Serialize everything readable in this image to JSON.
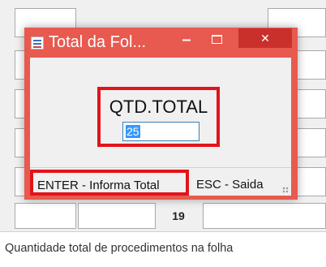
{
  "dialog": {
    "title": "Total da Fol...",
    "minimize": "–",
    "close": "✕",
    "field_label": "QTD.TOTAL",
    "field_value": "25",
    "status_enter": "ENTER - Informa Total",
    "status_esc": "ESC - Saida"
  },
  "background": {
    "row_number": "19",
    "status_text": "Quantidade total de procedimentos na folha"
  },
  "colors": {
    "dialog_frame": "#e8594f",
    "close_button": "#c9302c",
    "highlight_border": "#e2141a",
    "selection": "#3399ff"
  },
  "icons": {
    "app": "app-icon",
    "minimize": "minimize-icon",
    "maximize": "maximize-icon",
    "close": "close-icon",
    "grip": "resize-grip-icon"
  }
}
